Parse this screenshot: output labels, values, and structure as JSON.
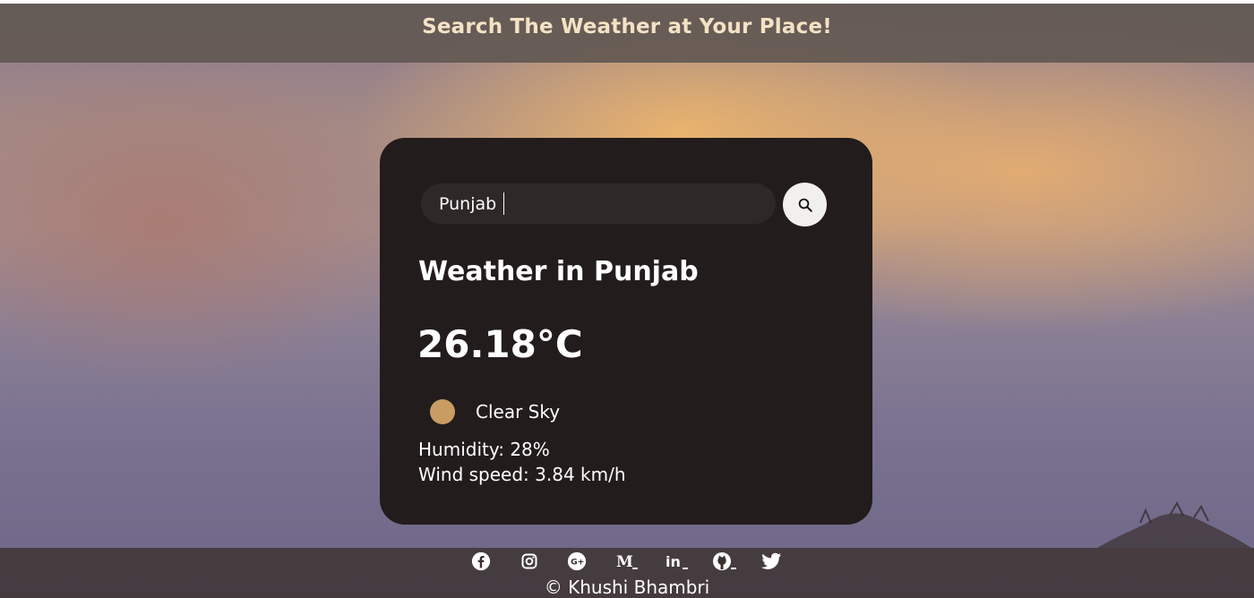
{
  "header": {
    "title": "Search The Weather at Your Place!"
  },
  "search": {
    "value": "Punjab",
    "placeholder": "Search",
    "icon": "search-icon"
  },
  "weather": {
    "city_title": "Weather in Punjab",
    "temperature": "26.18°C",
    "description": "Clear Sky",
    "humidity": "Humidity: 28%",
    "wind": "Wind speed: 3.84 km/h",
    "icon": "weather-icon"
  },
  "footer": {
    "social_icons": [
      "facebook-icon",
      "instagram-icon",
      "google-plus-icon",
      "medium-icon",
      "linkedin-icon",
      "github-icon",
      "twitter-icon"
    ],
    "copyright": "© Khushi Bhambri"
  },
  "colors": {
    "card_background": "#231c1c",
    "header_text": "#f4e2c6",
    "weather_icon": "#c99c63"
  }
}
